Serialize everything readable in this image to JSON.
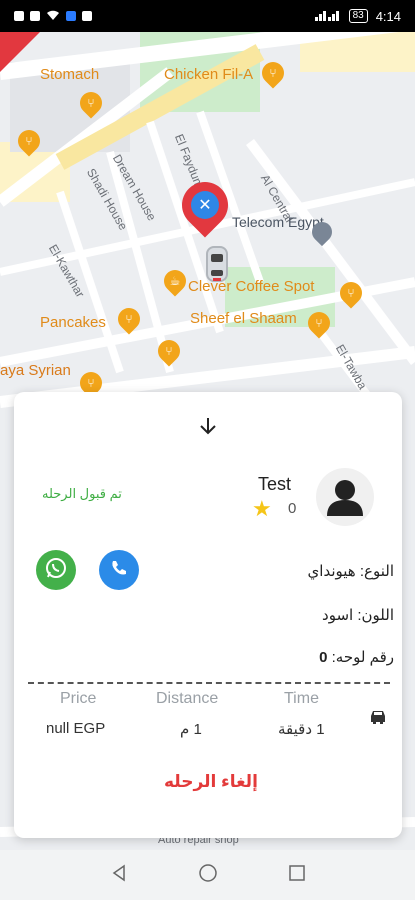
{
  "status_bar": {
    "time": "4:14",
    "battery": "83"
  },
  "map": {
    "labels": {
      "stomach": "Stomach",
      "chicken_fila": "Chicken Fil-A",
      "telecom": "Telecom Egypt",
      "clever_coffee": "Clever Coffee Spot",
      "pancakes": "Pancakes",
      "sheef": "Sheef el Shaam",
      "syrian": "aya Syrian",
      "auto_repair": "Auto repair shop",
      "el_kawthar": "El-Kawthar",
      "shadi_house": "Shadi House",
      "dream_house": "Dream House",
      "el_faydumy": "El Faydumy",
      "al_central": "Al Central",
      "el_tawba": "El-Tawba"
    }
  },
  "sheet": {
    "collapse_icon": "arrow-down-icon",
    "trip_status": "تم قبول الرحله",
    "driver_name": "Test",
    "rating": "0",
    "car_type_label": "النوع:",
    "car_type_value": "هيونداي",
    "car_color_label": "اللون:",
    "car_color_value": "اسود",
    "plate_label": "رقم لوحه:",
    "plate_value": "0",
    "columns": {
      "price_header": "Price",
      "distance_header": "Distance",
      "time_header": "Time",
      "price_value": "null EGP",
      "distance_value": "1 م",
      "time_value": "1 دقيقة"
    },
    "cancel_label": "إلغاء الرحله"
  },
  "colors": {
    "accepted_green": "#3fae44",
    "whatsapp_green": "#43b04a",
    "call_blue": "#2b8be8",
    "cancel_red": "#e33a3a",
    "marker_red": "#e2383f",
    "poi_orange": "#f2a51a"
  }
}
